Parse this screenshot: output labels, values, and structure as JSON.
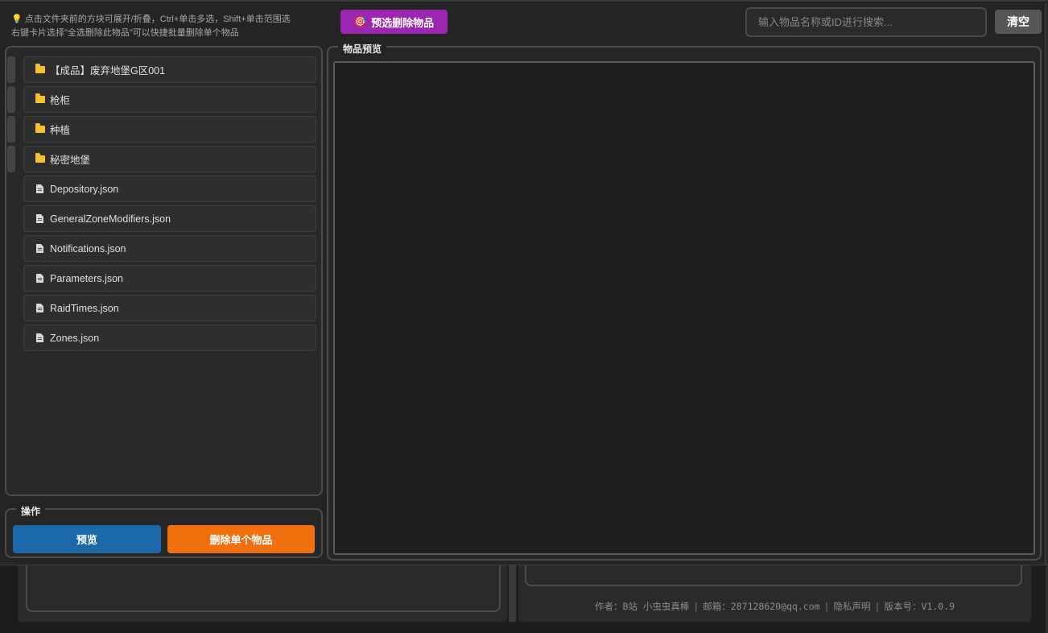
{
  "header": {
    "hint_line1": "点击文件夹前的方块可展开/折叠，Ctrl+单击多选，Shift+单击范围选",
    "hint_line2": "右键卡片选择\"全选删除此物品\"可以快捷批量删除单个物品",
    "preselect_label": "预选删除物品",
    "search_placeholder": "输入物品名称或ID进行搜索...",
    "clear_label": "清空"
  },
  "tree": {
    "items": [
      {
        "type": "folder",
        "label": "【成品】废弃地堡G区001"
      },
      {
        "type": "folder",
        "label": "枪柜"
      },
      {
        "type": "folder",
        "label": "种植"
      },
      {
        "type": "folder",
        "label": "秘密地堡"
      },
      {
        "type": "file",
        "label": "Depository.json"
      },
      {
        "type": "file",
        "label": "GeneralZoneModifiers.json"
      },
      {
        "type": "file",
        "label": "Notifications.json"
      },
      {
        "type": "file",
        "label": "Parameters.json"
      },
      {
        "type": "file",
        "label": "RaidTimes.json"
      },
      {
        "type": "file",
        "label": "Zones.json"
      }
    ]
  },
  "ops": {
    "title": "操作",
    "preview_label": "预览",
    "delete_label": "删除单个物品"
  },
  "preview": {
    "title": "物品预览"
  },
  "footer": {
    "author": "作者：B站 小虫虫真棒",
    "email": "邮箱：287128620@qq.com",
    "privacy": "隐私声明",
    "version": "版本号：V1.0.9"
  },
  "colors": {
    "preselect": "#9b27b0",
    "preview_button": "#1b69a8",
    "delete_button": "#f07010",
    "folder": "#f5c032"
  }
}
